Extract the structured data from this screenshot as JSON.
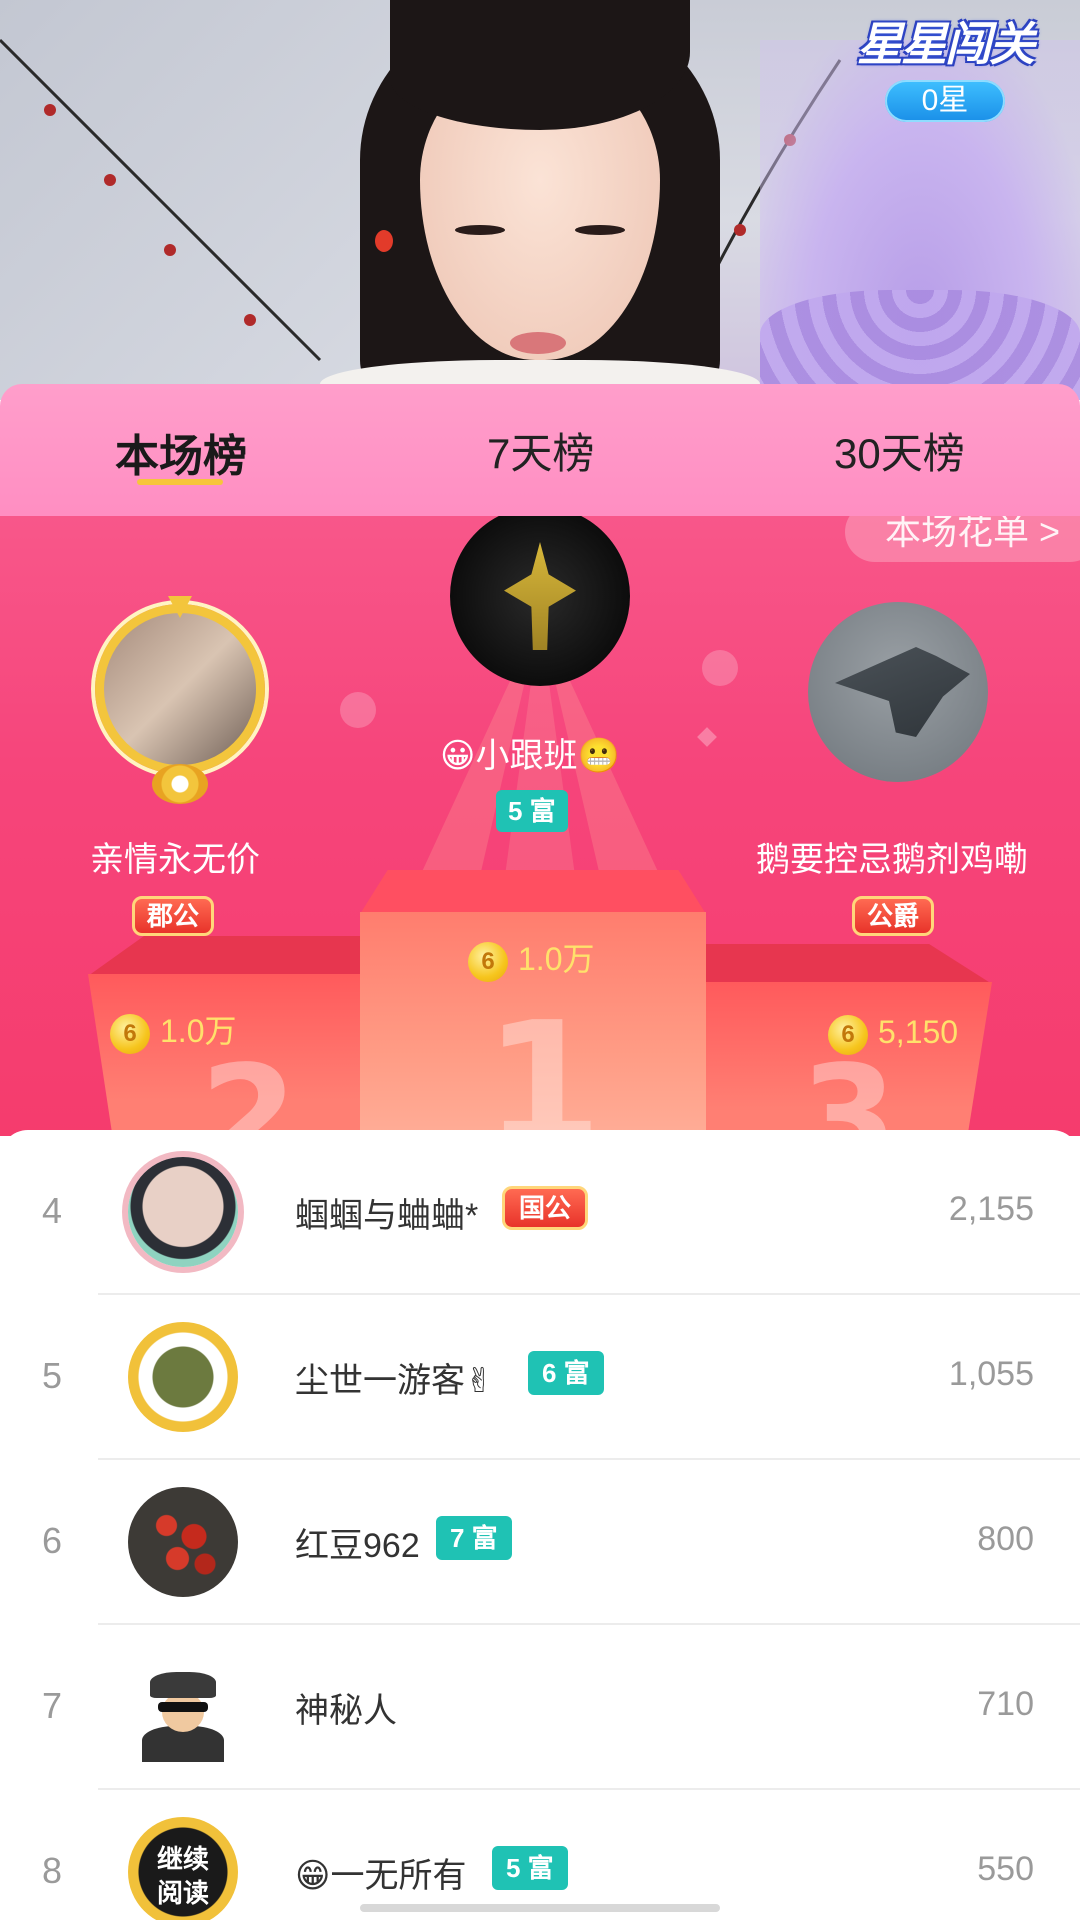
{
  "stream": {
    "game_title": "星星闯关",
    "stars": "0星"
  },
  "tabs": [
    {
      "label": "本场榜",
      "active": true
    },
    {
      "label": "7天榜",
      "active": false
    },
    {
      "label": "30天榜",
      "active": false
    }
  ],
  "podium": {
    "more_link": "本场花单 >",
    "first": {
      "rank": "1",
      "name": "😀小跟班😬",
      "badge": "5 富",
      "value": "1.0万",
      "coin": "6"
    },
    "second": {
      "rank": "2",
      "name": "亲情永无价",
      "badge": "郡公",
      "value": "1.0万",
      "coin": "6"
    },
    "third": {
      "rank": "3",
      "name": "鹅要控忌鹅剂鸡嘞",
      "badge": "公爵",
      "value": "5,150",
      "coin": "6"
    }
  },
  "list": [
    {
      "rank": "4",
      "name": "蝈蝈与蛐蛐*",
      "badge": "国公",
      "badge_type": "noble",
      "score": "2,155"
    },
    {
      "rank": "5",
      "name": "尘世一游客✌",
      "badge": "6 富",
      "badge_type": "rich",
      "score": "1,055"
    },
    {
      "rank": "6",
      "name": "红豆962",
      "badge": "7 富",
      "badge_type": "rich",
      "score": "800"
    },
    {
      "rank": "7",
      "name": "神秘人",
      "badge": "",
      "badge_type": "none",
      "score": "710"
    },
    {
      "rank": "8",
      "name": "😁一无所有",
      "badge": "5 富",
      "badge_type": "rich",
      "score": "550"
    }
  ],
  "avatar8_text": [
    "继续",
    "阅读"
  ],
  "colors": {
    "tab_bg": "#ff9ecb",
    "podium_bg": "#f6457b",
    "rich_badge": "#1fc2b4",
    "noble_badge": "#e8332a",
    "gift_value": "#ffe16b",
    "tab_underline": "#f7c53b"
  }
}
